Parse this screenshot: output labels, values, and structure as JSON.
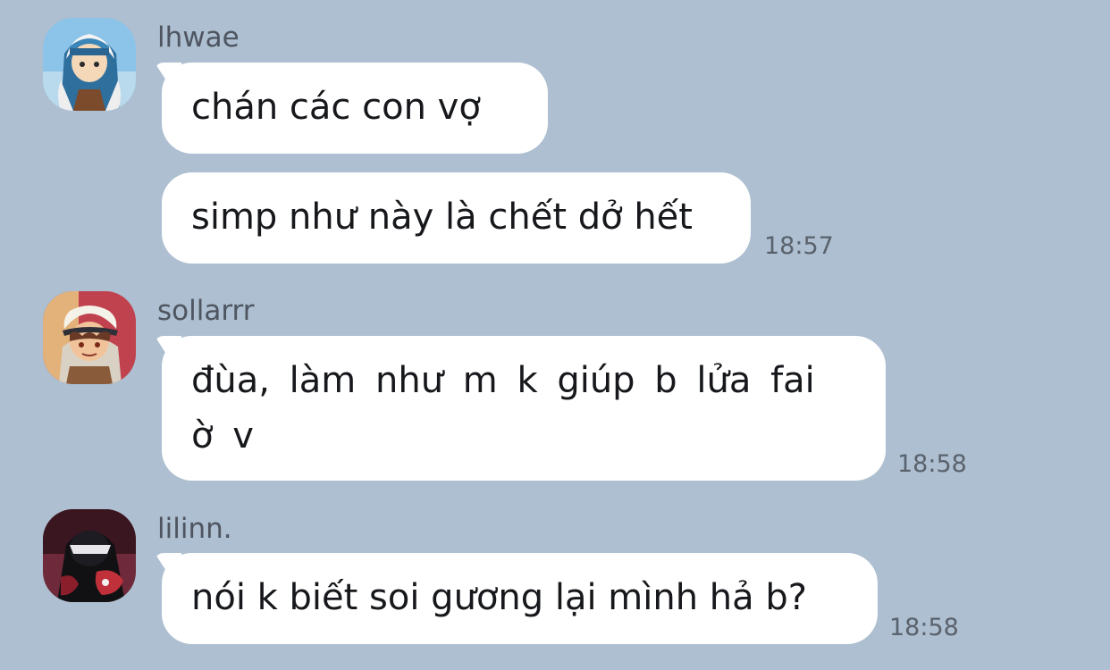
{
  "messages": [
    {
      "sender": "lhwae",
      "avatar_icon": "avatar-boy-blue-hood-icon",
      "bubbles": [
        {
          "text": "chán các con vợ",
          "time": ""
        },
        {
          "text": "simp như này là chết dở hết",
          "time": "18:57"
        }
      ]
    },
    {
      "sender": "sollarrr",
      "avatar_icon": "avatar-boy-white-cap-icon",
      "bubbles": [
        {
          "text": "đùa, làm như m k giúp b lửa fai ờ v",
          "time": "18:58"
        }
      ]
    },
    {
      "sender": "lilinn.",
      "avatar_icon": "avatar-dark-figure-red-icon",
      "bubbles": [
        {
          "text": "nói k biết soi gương lại mình hả b?",
          "time": "18:58"
        }
      ]
    }
  ],
  "colors": {
    "background": "#adbfd0",
    "bubble": "#ffffff",
    "name_text": "#4e5560",
    "time_text": "#5a626d"
  }
}
